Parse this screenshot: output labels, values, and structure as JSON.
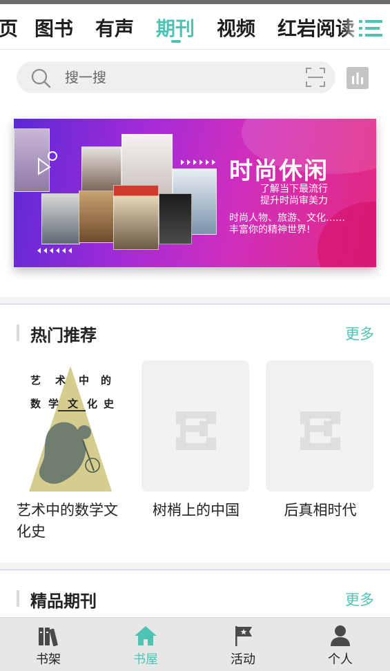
{
  "top_tabs": {
    "items": [
      {
        "label": "首页"
      },
      {
        "label": "图书"
      },
      {
        "label": "有声"
      },
      {
        "label": "期刊"
      },
      {
        "label": "视频"
      },
      {
        "label": "红岩阅读"
      }
    ],
    "active_index": 3,
    "menu_icon": "list-menu-icon"
  },
  "search": {
    "placeholder": "搜一搜",
    "value": "",
    "search_icon": "search-icon",
    "scan_icon": "scan-icon",
    "rank_icon": "bar-chart-icon"
  },
  "banner": {
    "title": "时尚休闲",
    "line1": "了解当下最流行",
    "line2": "提升时尚审美力",
    "line3": "时尚人物、旅游、文化……",
    "line4": "丰富你的精神世界!"
  },
  "hot_section": {
    "title": "热门推荐",
    "more": "更多",
    "books": [
      {
        "title": "艺术中的数学文化史",
        "cover_chars_row1": [
          "艺",
          "术",
          "中",
          "的"
        ],
        "cover_chars_row2": [
          "数",
          "学",
          "文",
          "化",
          "史"
        ]
      },
      {
        "title": "树梢上的中国"
      },
      {
        "title": "后真相时代"
      }
    ]
  },
  "journal_section": {
    "title": "精品期刊",
    "more": "更多"
  },
  "bottom_nav": {
    "items": [
      {
        "label": "书架",
        "icon": "bookshelf-icon"
      },
      {
        "label": "书屋",
        "icon": "home-icon"
      },
      {
        "label": "活动",
        "icon": "flag-icon"
      },
      {
        "label": "个人",
        "icon": "person-icon"
      }
    ],
    "active_index": 1
  },
  "colors": {
    "accent": "#4fc3b3",
    "banner_start": "#5b29d6",
    "banner_end": "#e3297f"
  }
}
